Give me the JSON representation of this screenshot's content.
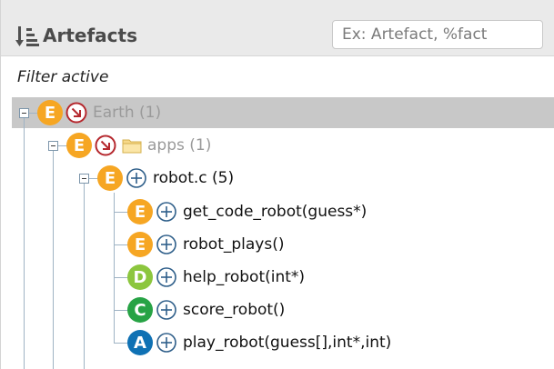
{
  "header": {
    "title": "Artefacts",
    "sort_icon": "sort-descending-icon",
    "search_placeholder": "Ex: Artefact, %fact"
  },
  "filter_status": "Filter active",
  "tree": [
    {
      "badge": "E",
      "status_icon": "arrow-down-right-icon",
      "folder": false,
      "label": "Earth (1)",
      "muted": true,
      "expanded": true
    },
    {
      "badge": "E",
      "status_icon": "arrow-down-right-icon",
      "folder": true,
      "label": "apps (1)",
      "muted": true,
      "expanded": true
    },
    {
      "badge": "E",
      "status_icon": "plus-icon",
      "folder": false,
      "label": "robot.c (5)",
      "muted": false,
      "expanded": true
    },
    {
      "badge": "E",
      "status_icon": "plus-icon",
      "folder": false,
      "label": "get_code_robot(guess*)",
      "muted": false
    },
    {
      "badge": "E",
      "status_icon": "plus-icon",
      "folder": false,
      "label": "robot_plays()",
      "muted": false
    },
    {
      "badge": "D",
      "status_icon": "plus-icon",
      "folder": false,
      "label": "help_robot(int*)",
      "muted": false
    },
    {
      "badge": "C",
      "status_icon": "plus-icon",
      "folder": false,
      "label": "score_robot()",
      "muted": false
    },
    {
      "badge": "A",
      "status_icon": "plus-icon",
      "folder": false,
      "label": "play_robot(guess[],int*,int)",
      "muted": false
    }
  ],
  "colors": {
    "badge_E": "#f6a623",
    "badge_D": "#8cc63e",
    "badge_C": "#27a345",
    "badge_A": "#0f71b4",
    "arrow_red": "#b5282e",
    "plus_blue": "#2f5f8a",
    "selected_row": "#c8c8c8"
  }
}
